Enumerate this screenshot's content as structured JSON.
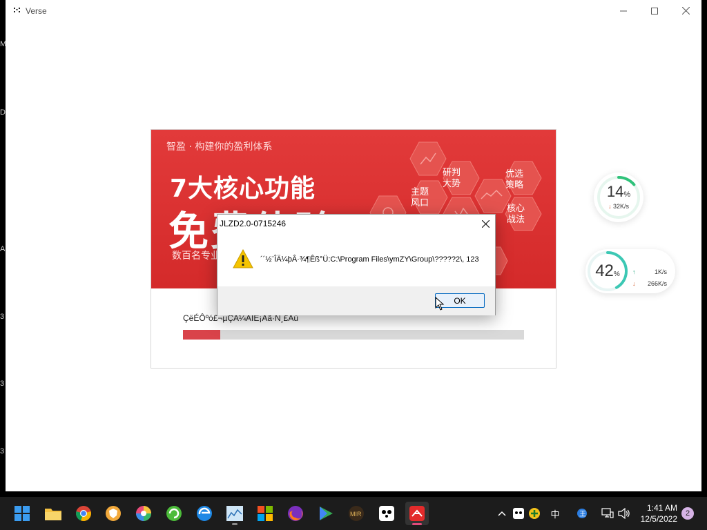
{
  "window": {
    "title": "Verse"
  },
  "edge_letters": [
    "M",
    "D",
    "A",
    "3",
    "3",
    "3"
  ],
  "installer": {
    "banner_subtitle": "智盈 · 构建你的盈利体系",
    "banner_headline": "7大核心功能",
    "banner_big": "免费体验",
    "banner_desc": "数百名专业",
    "hex_labels": [
      "研判\n大势",
      "主题\n风口",
      "优选\n策略",
      "核心\n战法"
    ],
    "status_text": "ÇëÉÔºó£¬µÇÂ¼ÄÎÊ¡Aã·N¸£Aü",
    "progress_percent": 11,
    "colors": {
      "banner": "#d42a2a",
      "progress": "#d9434a"
    }
  },
  "dialog": {
    "title": "JLZD2.0-0715246",
    "message": "´´½¨ÎÄ¼þÂ·¾¶Êß°Ü:C:\\Program Files\\ymZY\\Group\\?????2\\, 123",
    "ok_label": "OK",
    "icon": "warning-icon"
  },
  "monitor": {
    "widget1": {
      "percent": "14",
      "unit": "%",
      "speed": "32K/s",
      "level": 0.14
    },
    "widget2": {
      "percent": "42",
      "unit": "%",
      "up": "1K/s",
      "down": "266K/s",
      "level": 0.42
    }
  },
  "taskbar": {
    "apps": [
      "start-icon",
      "file-explorer-icon",
      "chrome-icon",
      "browser-icon",
      "colorful-app-icon",
      "green-app-icon",
      "edge-icon",
      "chart-app-icon",
      "store-icon",
      "firefox-icon",
      "play-icon",
      "game-icon",
      "panda-icon",
      "zhiying-icon"
    ],
    "time": "1:41 AM",
    "date": "12/5/2022",
    "notifications": "2",
    "ime": "中"
  }
}
